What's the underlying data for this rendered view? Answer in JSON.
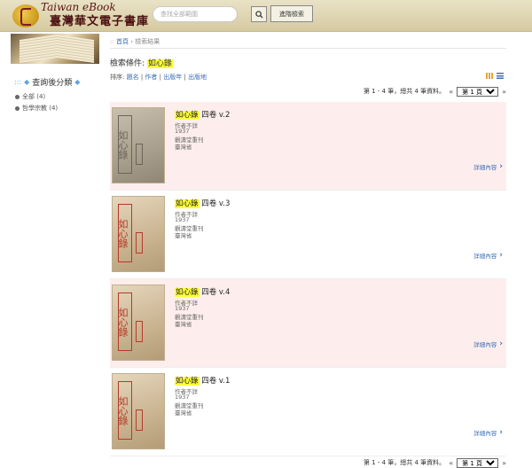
{
  "header": {
    "logo_en": "Taiwan eBook",
    "logo_zh": "臺灣華文電子書庫",
    "search_placeholder": "查找全部範圍",
    "search_icon": "search-icon",
    "advanced_label": "進階檢索"
  },
  "sidebar": {
    "facet_title": "查詢後分類",
    "facets": [
      {
        "label": "全部 (4)"
      },
      {
        "label": "哲學宗教 (4)"
      }
    ]
  },
  "breadcrumb": {
    "home": "首頁",
    "separator": "›",
    "current": "檢索結果"
  },
  "query": {
    "prefix": "檢索條件:",
    "term": "如心錄"
  },
  "sort": {
    "prefix": "排序:",
    "options": [
      "題名",
      "作者",
      "出版年",
      "出版地"
    ],
    "separator": "|"
  },
  "pager": {
    "text": "第 1 - 4 筆，總共 4 筆資料。",
    "prev": "«",
    "next": "»",
    "page_option": "第 1 頁"
  },
  "results": [
    {
      "title_hl": "如心錄",
      "title_rest": " 四卷 v.2",
      "author": "作者不詳",
      "year": "1937",
      "publisher": "觀濤堂重刊",
      "place": "臺灣省",
      "detail": "詳細內容",
      "cover_text": "如心錄"
    },
    {
      "title_hl": "如心錄",
      "title_rest": " 四卷 v.3",
      "author": "作者不詳",
      "year": "1937",
      "publisher": "觀濤堂重刊",
      "place": "臺灣省",
      "detail": "詳細內容",
      "cover_text": "如心錄"
    },
    {
      "title_hl": "如心錄",
      "title_rest": " 四卷 v.4",
      "author": "作者不詳",
      "year": "1937",
      "publisher": "觀濤堂重刊",
      "place": "臺灣省",
      "detail": "詳細內容",
      "cover_text": "如心錄"
    },
    {
      "title_hl": "如心錄",
      "title_rest": " 四卷 v.1",
      "author": "作者不詳",
      "year": "1937",
      "publisher": "觀濤堂重刊",
      "place": "臺灣省",
      "detail": "詳細內容",
      "cover_text": "如心錄"
    }
  ]
}
